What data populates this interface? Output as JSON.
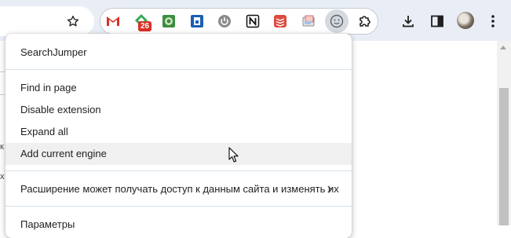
{
  "toolbar": {
    "bookmark_icon": "star-icon",
    "extensions": [
      {
        "name": "gmail-icon",
        "color": "#d93025"
      },
      {
        "name": "green-shield-icon",
        "color": "#34a853",
        "badge": "26"
      },
      {
        "name": "green-square-icon",
        "color": "#3c8d40"
      },
      {
        "name": "blue-lock-icon",
        "color": "#1a5fb4"
      },
      {
        "name": "power-icon",
        "color": "#7d7d7d"
      },
      {
        "name": "notion-icon",
        "color": "#111111"
      },
      {
        "name": "todoist-icon",
        "color": "#db4c3f"
      },
      {
        "name": "screenshot-icon",
        "color": "#888888"
      },
      {
        "name": "smiley-icon",
        "color": "#5f6368",
        "active": true
      }
    ],
    "right_icons": [
      "puzzle-icon",
      "download-icon",
      "side-panel-icon",
      "avatar",
      "kebab-menu-icon"
    ]
  },
  "menu": {
    "title": "SearchJumper",
    "items": [
      {
        "label": "Find in page"
      },
      {
        "label": "Disable extension"
      },
      {
        "label": "Expand all"
      },
      {
        "label": "Add current engine",
        "hovered": true
      }
    ],
    "site_access": "Расширение может получать доступ к данным сайта и изменять их",
    "settings": "Параметры"
  },
  "page": {
    "fragment_1": "к",
    "fragment_2": "х"
  }
}
